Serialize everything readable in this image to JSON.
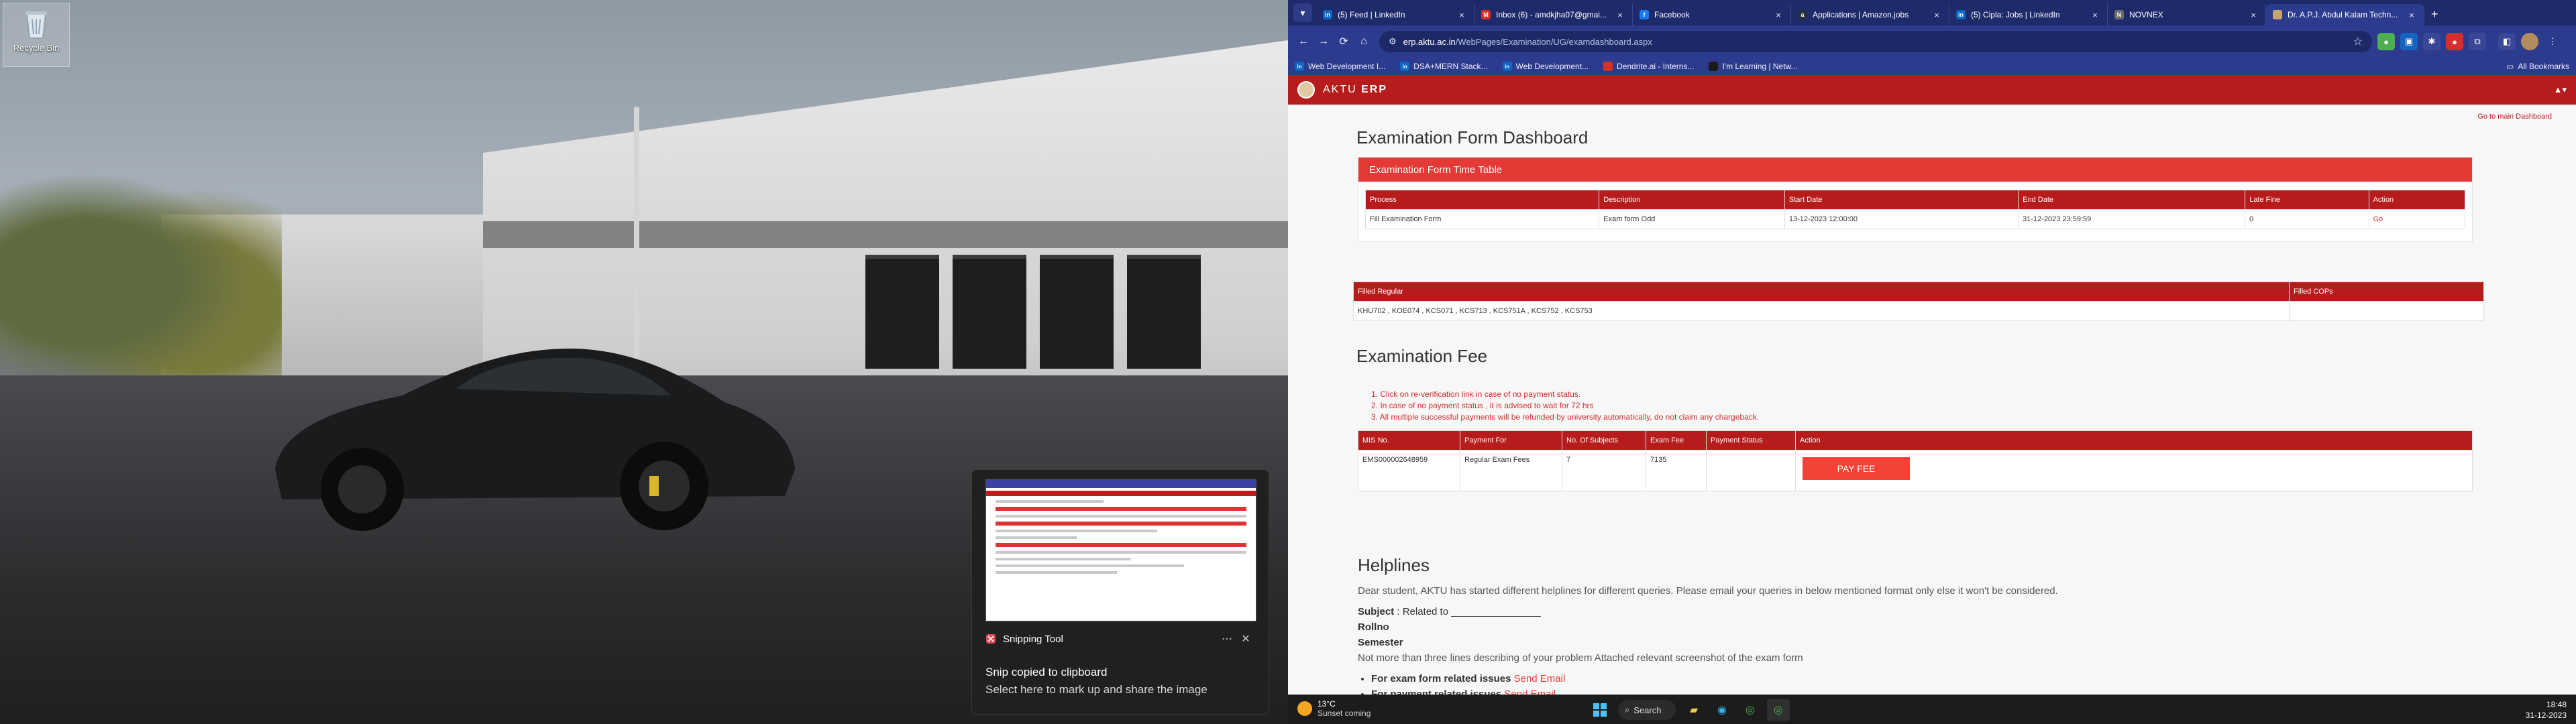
{
  "desktop": {
    "recycle_bin_label": "Recycle Bin"
  },
  "snip": {
    "app_name": "Snipping Tool",
    "title": "Snip copied to clipboard",
    "subtitle": "Select here to mark up and share the image",
    "more": "⋯",
    "close": "✕"
  },
  "browser": {
    "tabs": [
      {
        "label": "(5) Feed | LinkedIn",
        "fav": "in",
        "color": "#0a66c2"
      },
      {
        "label": "Inbox (6) - amdkjha07@gmai...",
        "fav": "M",
        "color": "#d93025"
      },
      {
        "label": "Facebook",
        "fav": "f",
        "color": "#1877f2"
      },
      {
        "label": "Applications | Amazon.jobs",
        "fav": "a",
        "color": "#232f3e"
      },
      {
        "label": "(5) Cipla: Jobs | LinkedIn",
        "fav": "in",
        "color": "#0a66c2"
      },
      {
        "label": "NOVNEX",
        "fav": "N",
        "color": "#6b6b6b"
      },
      {
        "label": "Dr. A.P.J. Abdul Kalam Techn...",
        "fav": "",
        "color": "#c7a46b"
      }
    ],
    "url_host": "erp.aktu.ac.in",
    "url_path": "/WebPages/Examination/UG/examdashboard.aspx",
    "bookmarks": [
      {
        "label": "Web Development I...",
        "fav": "in",
        "color": "#0a66c2"
      },
      {
        "label": "DSA+MERN Stack...",
        "fav": "in",
        "color": "#0a66c2"
      },
      {
        "label": "Web Development...",
        "fav": "in",
        "color": "#0a66c2"
      },
      {
        "label": "Dendrite.ai - Interns...",
        "fav": "",
        "color": "#d93025"
      },
      {
        "label": "I'm Learning | Netw...",
        "fav": "",
        "color": "#1b1b1b"
      }
    ],
    "all_bookmarks": "All Bookmarks"
  },
  "erp": {
    "brand_light": "AKTU ",
    "brand_bold": "ERP",
    "user_menu": "▲▾",
    "main_dashboard_link": "Go to main Dashboard",
    "page_title": "Examination Form Dashboard",
    "timetable": {
      "title": "Examination Form Time Table",
      "headers": [
        "Process",
        "Description",
        "Start Date",
        "End Date",
        "Late Fine",
        "Action"
      ],
      "row": [
        "Fill Examination Form",
        "Exam form Odd",
        "13-12-2023 12:00:00",
        "31-12-2023 23:59:59",
        "0",
        "Go"
      ]
    },
    "filled": {
      "headers": [
        "Filled Regular",
        "Filled COPs"
      ],
      "row": [
        "KHU702 , KOE074 , KCS071 , KCS713 , KCS751A , KCS752 , KCS753",
        ""
      ]
    },
    "fee_title": "Examination Fee",
    "notes": [
      "1. Click on re-verification link in case of no payment status.",
      "2. In case of no payment status , it is advised to wait for 72 hrs",
      "3. All multiple successful payments will be refunded by university automatically, do not claim any chargeback."
    ],
    "fee_table": {
      "headers": [
        "MIS No.",
        "Payment For",
        "No. Of Subjects",
        "Exam Fee",
        "Payment Status",
        "Action"
      ],
      "row": [
        "EMS000002648959",
        "Regular Exam Fees",
        "7",
        "7135",
        ""
      ],
      "pay_button": "PAY FEE"
    },
    "helplines": {
      "title": "Helplines",
      "intro": "Dear student, AKTU has started different helplines for different queries. Please email your queries in below mentioned format only else it won't be considered.",
      "subject_label": "Subject",
      "subject_value": " : Related to ________________",
      "rollno": "Rollno",
      "semester": "Semester",
      "desc": "Not more than three lines describing of your problem Attached relevant screenshot of the exam form",
      "item1_label": "For exam form related issues ",
      "item1_link": "Send Email",
      "item2_label": "For payment related issues ",
      "item2_link": "Send Email"
    }
  },
  "taskbar": {
    "temp": "13°C",
    "weather_sub": "Sunset coming",
    "search": "Search",
    "time": "18:48",
    "date": "31-12-2023"
  }
}
